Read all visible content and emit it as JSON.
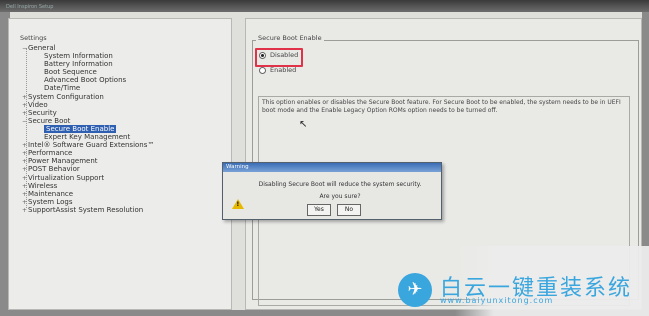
{
  "window": {
    "title": "Dell Inspiron Setup"
  },
  "left": {
    "title": "Settings",
    "tree": [
      {
        "label": "General",
        "exp": "−",
        "level": 0
      },
      {
        "label": "System Information",
        "level": 1
      },
      {
        "label": "Battery Information",
        "level": 1
      },
      {
        "label": "Boot Sequence",
        "level": 1
      },
      {
        "label": "Advanced Boot Options",
        "level": 1
      },
      {
        "label": "Date/Time",
        "level": 1
      },
      {
        "label": "System Configuration",
        "exp": "+",
        "level": 0
      },
      {
        "label": "Video",
        "exp": "+",
        "level": 0
      },
      {
        "label": "Security",
        "exp": "+",
        "level": 0
      },
      {
        "label": "Secure Boot",
        "exp": "−",
        "level": 0
      },
      {
        "label": "Secure Boot Enable",
        "level": 1,
        "selected": true
      },
      {
        "label": "Expert Key Management",
        "level": 1
      },
      {
        "label": "Intel® Software Guard Extensions™",
        "exp": "+",
        "level": 0
      },
      {
        "label": "Performance",
        "exp": "+",
        "level": 0
      },
      {
        "label": "Power Management",
        "exp": "+",
        "level": 0
      },
      {
        "label": "POST Behavior",
        "exp": "+",
        "level": 0
      },
      {
        "label": "Virtualization Support",
        "exp": "+",
        "level": 0
      },
      {
        "label": "Wireless",
        "exp": "+",
        "level": 0
      },
      {
        "label": "Maintenance",
        "exp": "+",
        "level": 0
      },
      {
        "label": "System Logs",
        "exp": "+",
        "level": 0
      },
      {
        "label": "SupportAssist System Resolution",
        "exp": "+",
        "level": 0
      }
    ]
  },
  "right": {
    "group_title": "Secure Boot Enable",
    "options": [
      {
        "label": "Disabled",
        "checked": true
      },
      {
        "label": "Enabled",
        "checked": false
      }
    ],
    "description": "This option enables or disables the Secure Boot feature. For Secure Boot to be enabled, the system needs to be in UEFI boot mode and the Enable Legacy Option ROMs option needs to be turned off."
  },
  "dialog": {
    "title": "Warning",
    "message": "Disabling Secure Boot will reduce the system security.",
    "question": "Are you sure?",
    "yes_label": "Yes",
    "no_label": "No"
  },
  "watermark": {
    "brand": "白云一键重装系统",
    "url": "www.baiyunxitong.com"
  },
  "colors": {
    "highlight": "#e0334a",
    "selection": "#2f5fb0",
    "watermark": "#3aa6de"
  }
}
